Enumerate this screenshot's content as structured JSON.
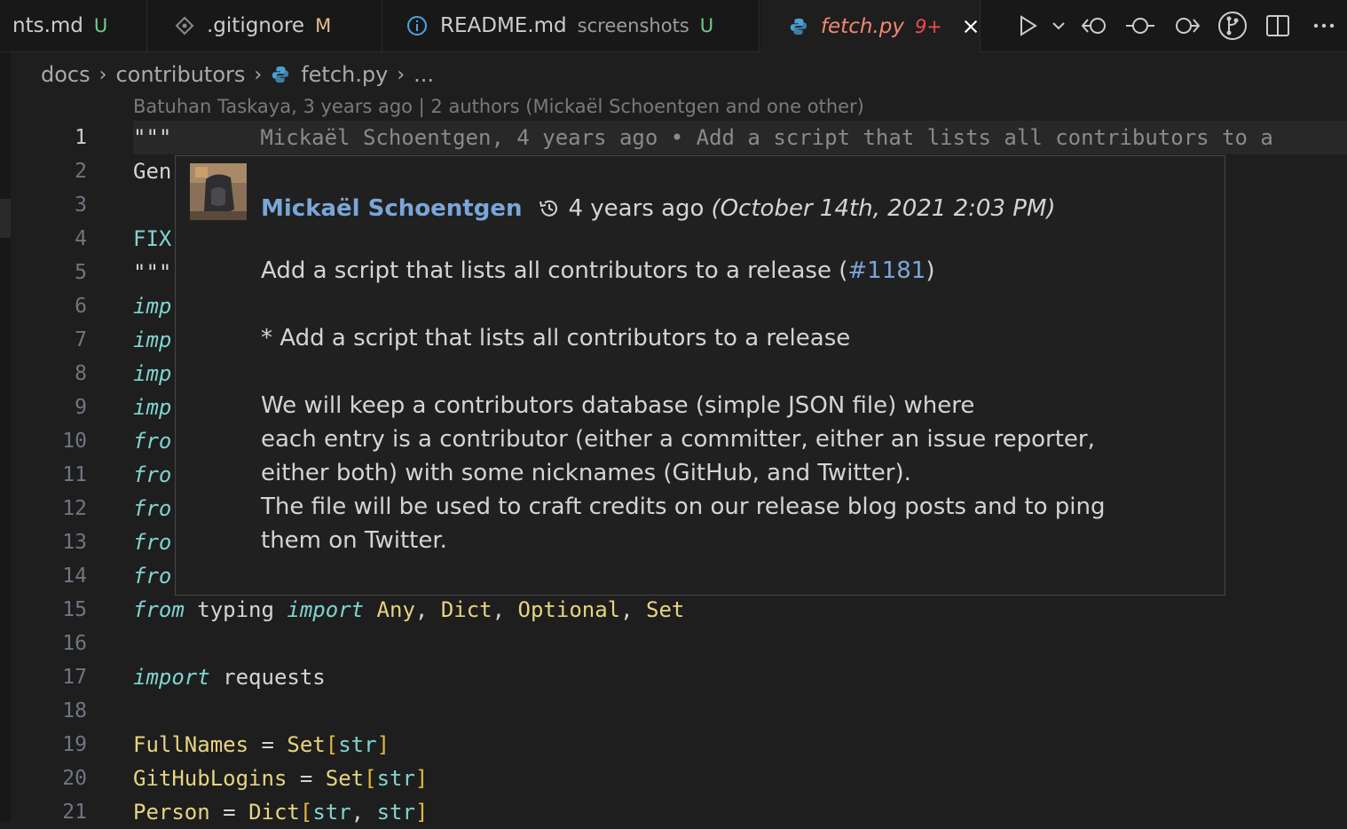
{
  "tabs": [
    {
      "name": "nts.md",
      "status": "U"
    },
    {
      "name": ".gitignore",
      "status": "M"
    },
    {
      "name": "README.md",
      "desc": "screenshots",
      "status": "U"
    },
    {
      "name": "fetch.py",
      "status": "9+"
    }
  ],
  "breadcrumbs": [
    "docs",
    "contributors",
    "fetch.py",
    "..."
  ],
  "blame_header": "Batuhan Taskaya, 3 years ago | 2 authors (Mickaël Schoentgen and one other)",
  "inline_blame": "Mickaël Schoentgen, 4 years ago • Add a script that lists all contributors to a",
  "line_numbers": [
    "1",
    "2",
    "3",
    "4",
    "5",
    "6",
    "7",
    "8",
    "9",
    "10",
    "11",
    "12",
    "13",
    "14",
    "15",
    "16",
    "17",
    "18",
    "19",
    "20",
    "21"
  ],
  "code": {
    "l1": "\"\"\"",
    "l2": "Gen",
    "l4": "FIX",
    "l5": "\"\"\"",
    "imp": "imp",
    "fro": "fro",
    "from": "from",
    "typing": " typing ",
    "import": "import",
    "any": "Any",
    "dict": "Dict",
    "optional": "Optional",
    "set": "Set",
    "requests": " requests",
    "fullnames": "FullNames",
    "githublogins": "GitHubLogins",
    "person": "Person",
    "str": "str"
  },
  "hover": {
    "author": "Mickaël Schoentgen",
    "ago": "4 years ago",
    "date": "(October 14th, 2021 2:03 PM)",
    "title_pre": "Add a script that lists all contributors to a release (",
    "issue": "#1181",
    "title_post": ")",
    "bullet": "* Add a script that lists all contributors to a release",
    "body1": "We will keep a contributors database (simple JSON file) where",
    "body2": "each entry is a contributor (either a committer, either an issue reporter,",
    "body3": "either both) with some nicknames (GitHub, and Twitter).",
    "body4": "The file will be used to craft credits on our release blog posts and to ping",
    "body5": "them on Twitter."
  }
}
